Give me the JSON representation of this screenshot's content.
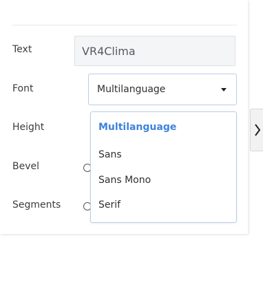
{
  "form": {
    "text_label": "Text",
    "text_value": "VR4Clima",
    "font_label": "Font",
    "font_selected": "Multilanguage",
    "height_label": "Height",
    "bevel_label": "Bevel",
    "segments_label": "Segments"
  },
  "dropdown": {
    "options": [
      "Multilanguage",
      "Sans",
      "Sans Mono",
      "Serif"
    ]
  },
  "icons": {
    "font_select_caret": "caret-down-icon",
    "side_panel_toggle": "chevron-right-icon"
  },
  "colors": {
    "accent": "#3d83dc",
    "focus_border": "#b8cdea"
  }
}
